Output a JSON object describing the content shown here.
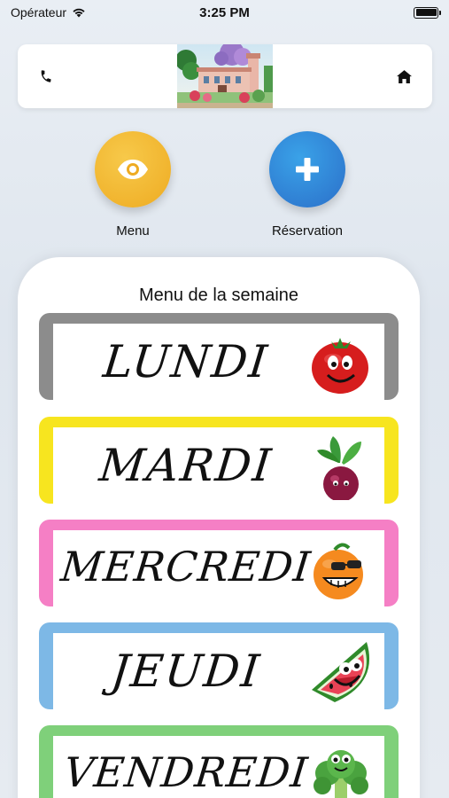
{
  "status_bar": {
    "carrier": "Opérateur",
    "time": "3:25 PM",
    "battery_level": 1.0
  },
  "header": {
    "phone_icon": "phone-icon",
    "home_icon": "home-icon",
    "image_icon": "building-photo"
  },
  "actions": [
    {
      "label": "Menu",
      "icon": "eye-icon",
      "color": "#f2b12e"
    },
    {
      "label": "Réservation",
      "icon": "plus-icon",
      "color": "#2b8ad8"
    }
  ],
  "week": {
    "title": "Menu de la semaine",
    "days": [
      {
        "name": "LUNDI",
        "color": "#8c8c8c",
        "icon": "tomato-icon"
      },
      {
        "name": "MARDI",
        "color": "#f7e51f",
        "icon": "beet-icon"
      },
      {
        "name": "MERCREDI",
        "color": "#f57fc5",
        "icon": "orange-icon"
      },
      {
        "name": "JEUDI",
        "color": "#7db8e6",
        "icon": "watermelon-icon"
      },
      {
        "name": "VENDREDI",
        "color": "#7fd07a",
        "icon": "broccoli-icon"
      }
    ]
  }
}
